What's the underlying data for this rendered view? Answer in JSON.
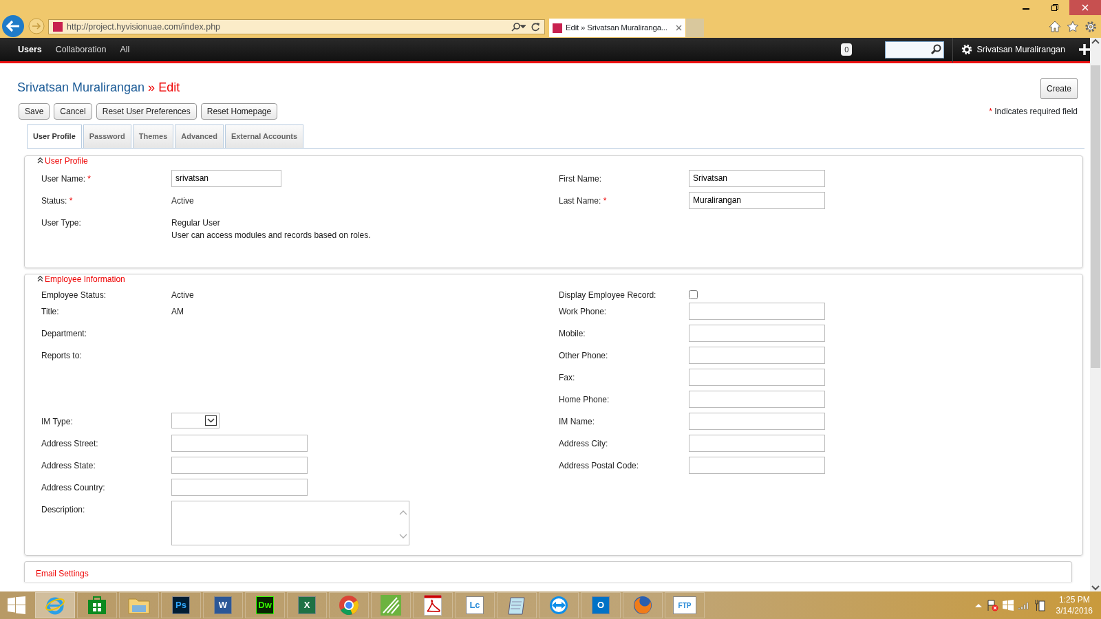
{
  "browser": {
    "url": "http://project.hyvisionuae.com/index.php",
    "tab_title": "Edit » Srivatsan Muraliranga..."
  },
  "nav": {
    "items": [
      {
        "label": "Users",
        "selected": true
      },
      {
        "label": "Collaboration",
        "selected": false
      },
      {
        "label": "All",
        "selected": false
      }
    ],
    "notifications": "0",
    "user": "Srivatsan Muralirangan"
  },
  "page": {
    "title": "Srivatsan Muralirangan",
    "separator": "»",
    "action": "Edit",
    "create_button": "Create",
    "buttons": [
      "Save",
      "Cancel",
      "Reset User Preferences",
      "Reset Homepage"
    ],
    "required_mark": "*",
    "required_note": "Indicates required field"
  },
  "tabs": [
    {
      "label": "User Profile",
      "selected": true
    },
    {
      "label": "Password",
      "selected": false
    },
    {
      "label": "Themes",
      "selected": false
    },
    {
      "label": "Advanced",
      "selected": false
    },
    {
      "label": "External Accounts",
      "selected": false
    }
  ],
  "sections": [
    {
      "title": "User Profile",
      "expanded": true,
      "rows": [
        {
          "left": {
            "label": "User Name:",
            "required": true,
            "kind": "input",
            "value": "srivatsan"
          },
          "right": {
            "label": "First Name:",
            "required": false,
            "kind": "input",
            "value": "Srivatsan"
          }
        },
        {
          "left": {
            "label": "Status:",
            "required": true,
            "kind": "text",
            "value": "Active"
          },
          "right": {
            "label": "Last Name:",
            "required": true,
            "kind": "input",
            "value": "Muralirangan"
          }
        },
        {
          "left": {
            "label": "User Type:",
            "required": false,
            "kind": "lines",
            "lines": [
              "Regular User",
              "User can access modules and records based on roles."
            ]
          }
        }
      ]
    },
    {
      "title": "Employee Information",
      "expanded": true,
      "rows": [
        {
          "left": {
            "label": "Employee Status:",
            "required": false,
            "kind": "text",
            "value": "Active"
          },
          "right": {
            "label": "Display Employee Record:",
            "required": false,
            "kind": "checkbox",
            "checked": false
          }
        },
        {
          "left": {
            "label": "Title:",
            "required": false,
            "kind": "text",
            "value": "AM"
          },
          "right": {
            "label": "Work Phone:",
            "required": false,
            "kind": "input"
          }
        },
        {
          "left": {
            "label": "Department:",
            "required": false,
            "kind": "text"
          },
          "right": {
            "label": "Mobile:",
            "required": false,
            "kind": "input"
          }
        },
        {
          "left": {
            "label": "Reports to:",
            "required": false,
            "kind": "text"
          },
          "right": {
            "label": "Other Phone:",
            "required": false,
            "kind": "input"
          }
        },
        {
          "right": {
            "label": "Fax:",
            "required": false,
            "kind": "input"
          }
        },
        {
          "right": {
            "label": "Home Phone:",
            "required": false,
            "kind": "input"
          }
        },
        {
          "left": {
            "label": "IM Type:",
            "required": false,
            "kind": "select"
          },
          "right": {
            "label": "IM Name:",
            "required": false,
            "kind": "input"
          }
        },
        {
          "left": {
            "label": "Address Street:",
            "required": false,
            "kind": "input"
          },
          "right": {
            "label": "Address City:",
            "required": false,
            "kind": "input"
          }
        },
        {
          "left": {
            "label": "Address State:",
            "required": false,
            "kind": "input"
          },
          "right": {
            "label": "Address Postal Code:",
            "required": false,
            "kind": "input"
          }
        },
        {
          "left": {
            "label": "Address Country:",
            "required": false,
            "kind": "input"
          }
        },
        {
          "left": {
            "label": "Description:",
            "required": false,
            "kind": "textarea"
          }
        }
      ]
    },
    {
      "title": "Email Settings",
      "expanded": false
    }
  ],
  "taskbar": {
    "apps": [
      {
        "kind": "ie",
        "selected": true
      },
      {
        "kind": "store",
        "selected": false
      },
      {
        "kind": "folder",
        "selected": false
      },
      {
        "kind": "tile",
        "label": "Ps",
        "color": "#001d34",
        "selected": false
      },
      {
        "kind": "tile",
        "label": "W",
        "color": "#2b5797",
        "selected": false
      },
      {
        "kind": "tile",
        "label": "Dw",
        "color": "#072401",
        "selected": false
      },
      {
        "kind": "tile",
        "label": "X",
        "color": "#1e7145",
        "selected": false
      },
      {
        "kind": "chrome",
        "selected": false
      },
      {
        "kind": "leaf",
        "selected": false
      },
      {
        "kind": "pdf",
        "selected": false
      },
      {
        "kind": "tile",
        "label": "Lc",
        "color": "#ffffff",
        "selected": false
      },
      {
        "kind": "pad",
        "selected": false
      },
      {
        "kind": "teamviewer",
        "selected": false
      },
      {
        "kind": "tile",
        "label": "O",
        "color": "#0072c6",
        "selected": false
      },
      {
        "kind": "firefox",
        "selected": false
      },
      {
        "kind": "tile",
        "label": "FTP",
        "color": "#ffffff",
        "selected": false
      }
    ],
    "time": "1:25 PM",
    "date": "3/14/2016"
  }
}
